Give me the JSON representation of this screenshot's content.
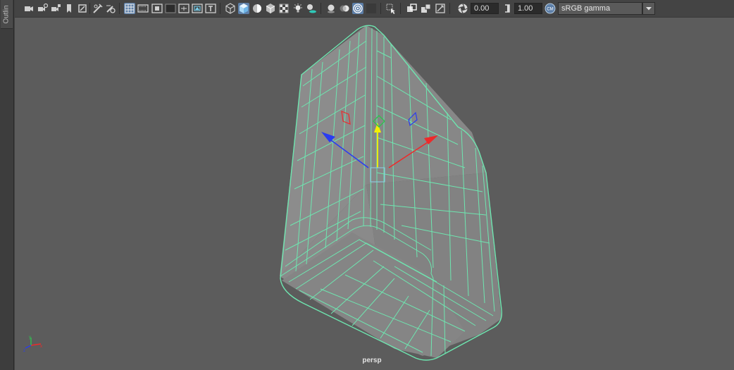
{
  "outliner": {
    "tab_label": "Outlin"
  },
  "toolbar": {
    "exposure_value": "0.00",
    "gamma_value": "1.00",
    "view_transform": "sRGB gamma",
    "icons": [
      "camera-select-icon",
      "camera-attributes-icon",
      "bookmarks-icon",
      "image-plane-icon",
      "2d-pan-zoom-icon",
      "grease-pencil-icon",
      "grid-icon",
      "film-gate-icon",
      "resolution-gate-icon",
      "gate-mask-icon",
      "field-chart-icon",
      "safe-action-icon",
      "safe-title-icon",
      "wireframe-icon",
      "smooth-shade-icon",
      "default-material-icon",
      "wireframe-on-shaded-icon",
      "textured-icon",
      "use-all-lights-icon",
      "shadows-icon",
      "screen-space-ao-icon",
      "motion-blur-icon",
      "anti-aliasing-icon",
      "depth-of-field-icon",
      "isolate-select-icon",
      "xray-icon",
      "xray-joints-icon",
      "backface-culling-icon",
      "exposure-icon",
      "gamma-icon",
      "color-management-icon"
    ]
  },
  "viewport": {
    "camera_name": "persp"
  },
  "colors": {
    "wire": "#6ee6b0",
    "x_axis": "#ee2a2a",
    "y_axis": "#f4f000",
    "z_axis": "#2a3cf0",
    "background": "#5c5c5c"
  }
}
